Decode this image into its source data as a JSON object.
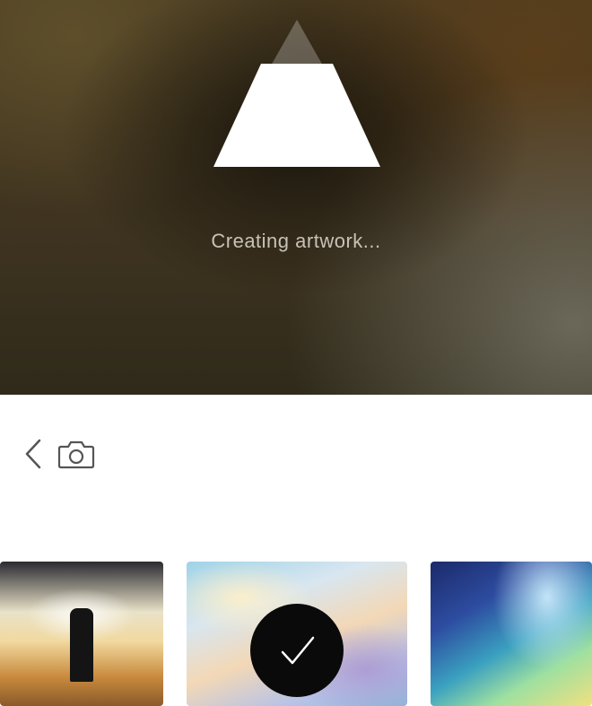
{
  "preview": {
    "status_text": "Creating artwork..."
  },
  "toolbar": {
    "back_icon": "chevron-left-icon",
    "camera_icon": "camera-icon"
  },
  "styles": {
    "selected_index": 1,
    "check_icon": "checkmark-icon",
    "items": [
      {
        "icon": "style-thumbnail-1"
      },
      {
        "icon": "style-thumbnail-2"
      },
      {
        "icon": "style-thumbnail-3"
      }
    ]
  },
  "colors": {
    "loader_fill": "#ffffff",
    "status_text": "#c7c2b6",
    "check_background": "#0a0a0a"
  }
}
